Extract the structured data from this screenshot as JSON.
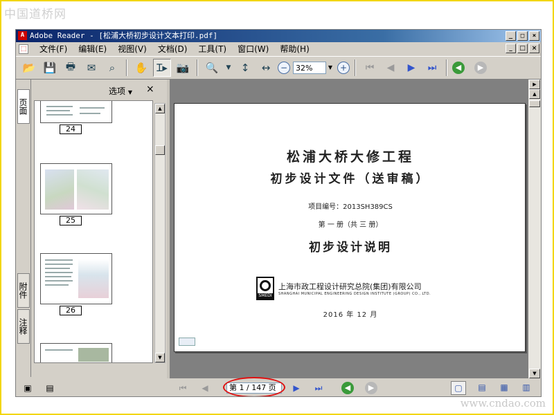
{
  "watermarks": {
    "top": "中国道桥网",
    "bottom": "www.cndao.com"
  },
  "window": {
    "title": "Adobe Reader - [松浦大桥初步设计文本打印.pdf]",
    "controls": {
      "minimize": "_",
      "maximize": "□",
      "close": "×"
    }
  },
  "menu": {
    "items": [
      {
        "label": "文件(F)"
      },
      {
        "label": "编辑(E)"
      },
      {
        "label": "视图(V)"
      },
      {
        "label": "文档(D)"
      },
      {
        "label": "工具(T)"
      },
      {
        "label": "窗口(W)"
      },
      {
        "label": "帮助(H)"
      }
    ]
  },
  "toolbar": {
    "zoom_value": "32%"
  },
  "nav_tabs": [
    {
      "label": "页面"
    },
    {
      "label": "附件"
    },
    {
      "label": "注释"
    }
  ],
  "thumbnail_panel": {
    "options_label": "选项",
    "close_label": "×",
    "thumbnails": [
      {
        "page": "24"
      },
      {
        "page": "25"
      },
      {
        "page": "26"
      }
    ]
  },
  "document_page": {
    "title_line1": "松浦大桥大修工程",
    "title_line2": "初步设计文件（送审稿）",
    "project_number": "项目编号：2013SH389CS",
    "volume": "第 一 册（共 三 册）",
    "title_line3": "初步设计说明",
    "logo_text": "SMEDI",
    "institute_cn": "上海市政工程设计研究总院(集团)有限公司",
    "institute_en": "SHANGHAI MUNICIPAL ENGINEERING DESIGN INSTITUTE (GROUP) CO., LTD.",
    "date": "2016 年 12 月"
  },
  "statusbar": {
    "page_indicator": "第 1 / 147 页"
  }
}
